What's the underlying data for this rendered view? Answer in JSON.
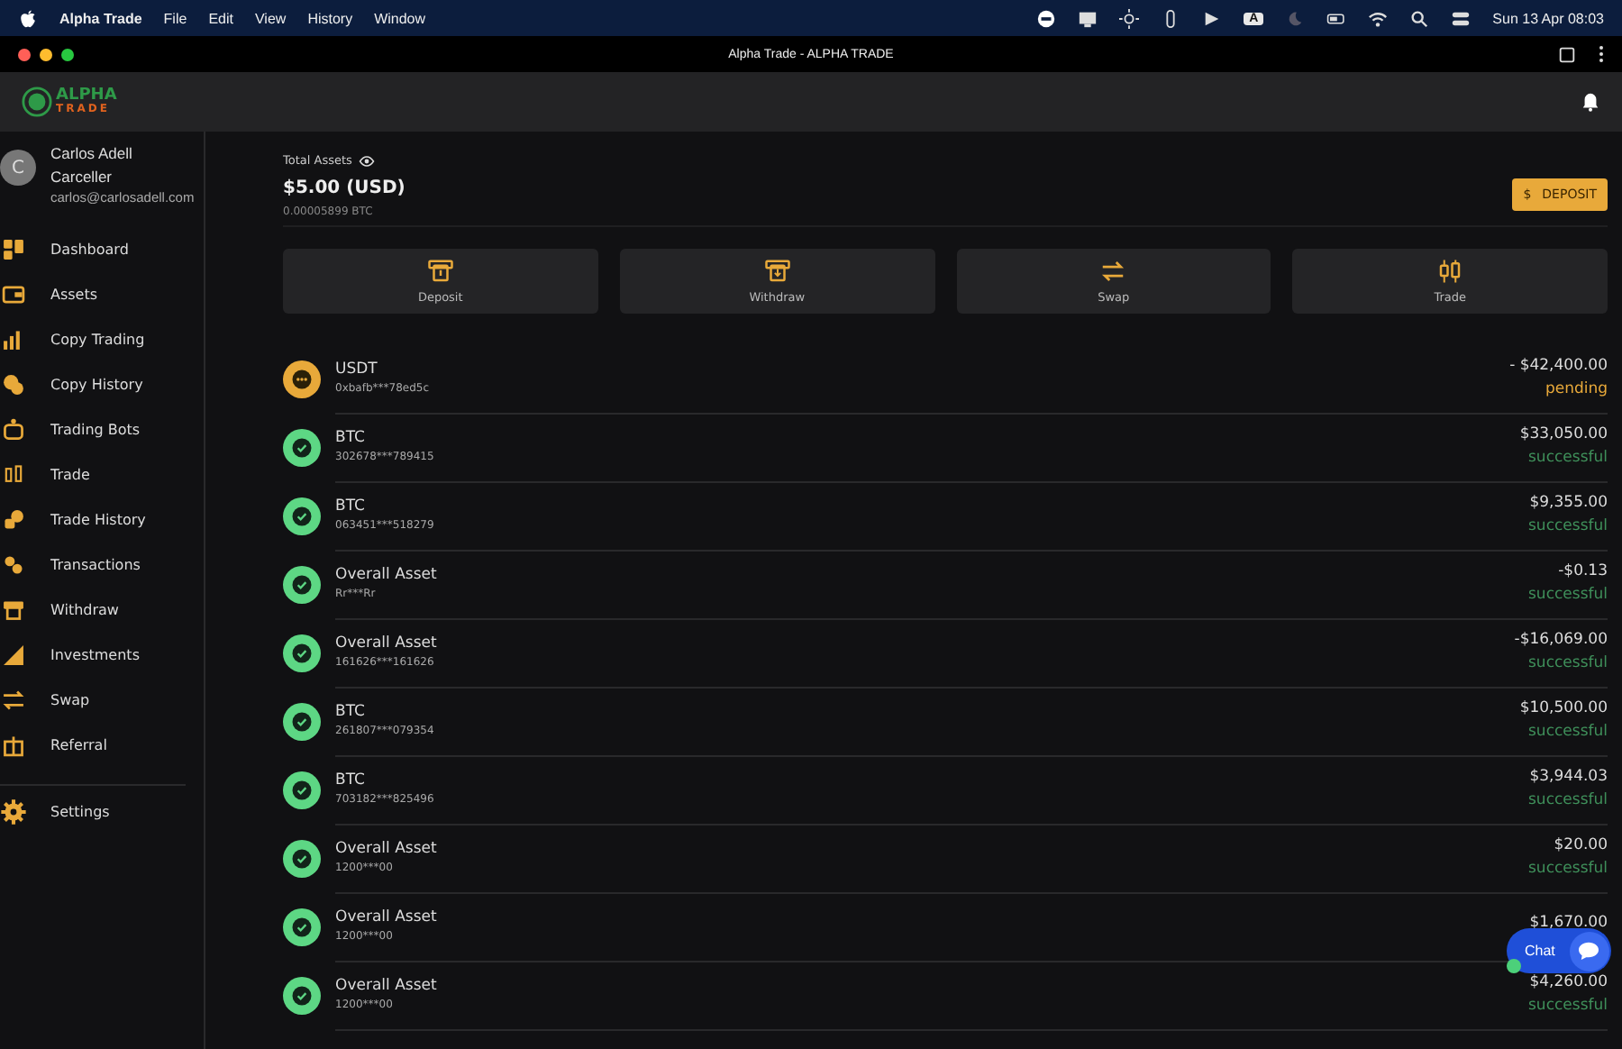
{
  "menubar": {
    "app": "Alpha Trade",
    "menus": [
      "File",
      "Edit",
      "View",
      "History",
      "Window"
    ],
    "input_source": "A",
    "clock": "Sun 13 Apr  08:03"
  },
  "window": {
    "title": "Alpha Trade - ALPHA TRADE"
  },
  "logo": {
    "top": "ALPHA",
    "bottom": "TRADE"
  },
  "profile": {
    "initial": "C",
    "name": "Carlos Adell Carceller",
    "email": "carlos@carlosadell.com"
  },
  "sidebar": {
    "items": [
      {
        "label": "Dashboard"
      },
      {
        "label": "Assets"
      },
      {
        "label": "Copy Trading"
      },
      {
        "label": "Copy History"
      },
      {
        "label": "Trading Bots"
      },
      {
        "label": "Trade"
      },
      {
        "label": "Trade History"
      },
      {
        "label": "Transactions"
      },
      {
        "label": "Withdraw"
      },
      {
        "label": "Investments"
      },
      {
        "label": "Swap"
      },
      {
        "label": "Referral"
      }
    ],
    "footer": {
      "label": "Settings"
    }
  },
  "summary": {
    "label": "Total Assets",
    "amount": "$5.00 (USD)",
    "btc": "0.00005899 BTC",
    "deposit_button": "DEPOSIT",
    "deposit_symbol": "$"
  },
  "actions": [
    {
      "label": "Deposit",
      "kind": "deposit"
    },
    {
      "label": "Withdraw",
      "kind": "withdraw"
    },
    {
      "label": "Swap",
      "kind": "swap"
    },
    {
      "label": "Trade",
      "kind": "trade"
    }
  ],
  "transactions": [
    {
      "asset": "USDT",
      "ref": "0xbafb***78ed5c",
      "amount": "- $42,400.00",
      "status": "pending",
      "kind": "pending"
    },
    {
      "asset": "BTC",
      "ref": "302678***789415",
      "amount": "$33,050.00",
      "status": "successful",
      "kind": "success"
    },
    {
      "asset": "BTC",
      "ref": "063451***518279",
      "amount": "$9,355.00",
      "status": "successful",
      "kind": "success"
    },
    {
      "asset": "Overall Asset",
      "ref": "Rr***Rr",
      "amount": "-$0.13",
      "status": "successful",
      "kind": "success"
    },
    {
      "asset": "Overall Asset",
      "ref": "161626***161626",
      "amount": "-$16,069.00",
      "status": "successful",
      "kind": "success"
    },
    {
      "asset": "BTC",
      "ref": "261807***079354",
      "amount": "$10,500.00",
      "status": "successful",
      "kind": "success"
    },
    {
      "asset": "BTC",
      "ref": "703182***825496",
      "amount": "$3,944.03",
      "status": "successful",
      "kind": "success"
    },
    {
      "asset": "Overall Asset",
      "ref": "1200***00",
      "amount": "$20.00",
      "status": "successful",
      "kind": "success"
    },
    {
      "asset": "Overall Asset",
      "ref": "1200***00",
      "amount": "$1,670.00",
      "kind": "success"
    },
    {
      "asset": "Overall Asset",
      "ref": "1200***00",
      "amount": "$4,260.00",
      "status": "successful",
      "kind": "success"
    }
  ],
  "chat": {
    "label": "Chat"
  }
}
